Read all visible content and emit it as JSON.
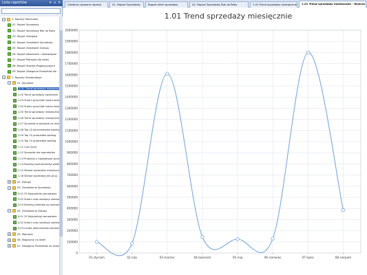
{
  "panel": {
    "title": "Lista raportów",
    "controls": [
      "▾",
      "▫",
      "✕"
    ],
    "search_value": ""
  },
  "tree": [
    {
      "level": 0,
      "expander": "−",
      "icon": "folder",
      "label": "1. Raporty Wzorcowe"
    },
    {
      "level": 1,
      "expander": "",
      "icon": "report",
      "label": "01. Raport Sprzedaży"
    },
    {
      "level": 1,
      "expander": "",
      "icon": "report",
      "label": "02. Raport Sprzedaży Rok do Roku"
    },
    {
      "level": 1,
      "expander": "",
      "icon": "report",
      "label": "03. Raport Zakupów"
    },
    {
      "level": 1,
      "expander": "",
      "icon": "report",
      "label": "04. Raport Zamówień Sprzedaży"
    },
    {
      "level": 1,
      "expander": "",
      "icon": "report",
      "label": "05. Raport Zamówień Zakupu"
    },
    {
      "level": 1,
      "expander": "",
      "icon": "report",
      "label": "06. Raport Należności i Zobowiązań"
    },
    {
      "level": 1,
      "expander": "",
      "icon": "report",
      "label": "07. Raport Płatności Na dzień"
    },
    {
      "level": 1,
      "expander": "",
      "icon": "report",
      "label": "08. Raport Stanów Magazynowych"
    },
    {
      "level": 1,
      "expander": "",
      "icon": "report",
      "label": "09. Raport Zalegania Produktów Na"
    },
    {
      "level": 0,
      "expander": "−",
      "icon": "folder",
      "label": "2. Raporty Standardowe"
    },
    {
      "level": 1,
      "expander": "−",
      "icon": "folder",
      "label": "01. Sprzedaż"
    },
    {
      "level": 2,
      "expander": "",
      "icon": "report",
      "label": "1.01. Trend sprzedaży miesięcznie",
      "selected": true
    },
    {
      "level": 2,
      "expander": "",
      "icon": "report",
      "label": "1.02 Trend sprzedaży kwartalnie"
    },
    {
      "level": 2,
      "expander": "",
      "icon": "report",
      "label": "1.03 Średni przychód marża miesięcznie"
    },
    {
      "level": 2,
      "expander": "",
      "icon": "report",
      "label": "1.04 Średni przychód marża kwartalnie"
    },
    {
      "level": 2,
      "expander": "",
      "icon": "report",
      "label": "1.05 Trend sprzedaży miesięcznie"
    },
    {
      "level": 2,
      "expander": "",
      "icon": "report",
      "label": "1.06 Trend sprzedaży miesięcznie"
    },
    {
      "level": 2,
      "expander": "",
      "icon": "report",
      "label": "1.07 Sprzedaż w podziale na miesiące"
    },
    {
      "level": 2,
      "expander": "",
      "icon": "report",
      "label": "1.08 Top 10 kontrahentów według"
    },
    {
      "level": 2,
      "expander": "",
      "icon": "report",
      "label": "1.09 Top 10 produktów według"
    },
    {
      "level": 2,
      "expander": "",
      "icon": "report",
      "label": "1.10 Top 10 produktów według"
    },
    {
      "level": 2,
      "expander": "",
      "icon": "report",
      "label": "1.11 Cykl życia"
    },
    {
      "level": 2,
      "expander": "",
      "icon": "report",
      "label": "1.12 Sprzedaż dla operatorów"
    },
    {
      "level": 2,
      "expander": "",
      "icon": "report",
      "label": "1.13 Produkty o największej sprzedaży"
    },
    {
      "level": 2,
      "expander": "",
      "icon": "report",
      "label": "1.14 Ranking kontrahentów według"
    },
    {
      "level": 2,
      "expander": "",
      "icon": "report",
      "label": "1.15 Wzrost sprzedaży miesięcznie"
    },
    {
      "level": 2,
      "expander": "",
      "icon": "report",
      "label": "1.16 Wzrost sprzedaży dla grup"
    },
    {
      "level": 1,
      "expander": "+",
      "icon": "folder",
      "label": "02. Zakupy"
    },
    {
      "level": 1,
      "expander": "−",
      "icon": "folder",
      "label": "03. Zamówienia Sprzedaży"
    },
    {
      "level": 2,
      "expander": "",
      "icon": "report",
      "label": "3.01 25 Najczęściej zamawiane"
    },
    {
      "level": 2,
      "expander": "",
      "icon": "report",
      "label": "3.02 Średni czas realizacji zamówień"
    },
    {
      "level": 2,
      "expander": "",
      "icon": "report",
      "label": "3.03 Ranking klientów po wartości"
    },
    {
      "level": 1,
      "expander": "−",
      "icon": "folder",
      "label": "04. Zamówienia Zakupu"
    },
    {
      "level": 2,
      "expander": "",
      "icon": "report",
      "label": "4.01 25 Najczęściej zamawiane"
    },
    {
      "level": 2,
      "expander": "",
      "icon": "report",
      "label": "4.02 Średni czas realizacji zamówień"
    },
    {
      "level": 2,
      "expander": "",
      "icon": "report",
      "label": "4.03 Liczba dokumentów zamówień"
    },
    {
      "level": 1,
      "expander": "+",
      "icon": "folder",
      "label": "05. Płatności"
    },
    {
      "level": 1,
      "expander": "+",
      "icon": "folder",
      "label": "06. Magazyny na dzień"
    },
    {
      "level": 1,
      "expander": "+",
      "icon": "folder",
      "label": "07. Zaleganie Produktów na dzień"
    }
  ],
  "tabs": [
    {
      "label": "Ostatnio używane raporty",
      "active": false
    },
    {
      "label": "01. Raport Sprzedaży",
      "active": false
    },
    {
      "label": "Raport ofert sprzedaży",
      "active": false
    },
    {
      "label": "02. Raport Sprzedaży Rok do Roku",
      "active": false
    },
    {
      "label": "1.01 Trend sprzedaży miesięcznie",
      "active": false
    },
    {
      "label": "1.01 Trend sprzedaży miesięcznie - Wykres",
      "active": true
    }
  ],
  "colors": {
    "line": "#7aa7dc",
    "marker_fill": "#ffffff",
    "grid": "#d0d8e6",
    "selected": "#2f63b6"
  },
  "chart_data": {
    "type": "line",
    "title": "1.01 Trend sprzedaży miesięcznie",
    "categories": [
      "01 styczeń",
      "02 luty",
      "03 marzec",
      "04 kwiecień",
      "05 maj",
      "06 czerwiec",
      "07 lipiec",
      "08 sierpień"
    ],
    "values": [
      100000,
      85000,
      1610000,
      145000,
      125000,
      130000,
      1800000,
      385000
    ],
    "ylim": [
      0,
      2000000
    ],
    "yticks": [
      "0",
      "100000",
      "200000",
      "300000",
      "400000",
      "500000",
      "600000",
      "700000",
      "800000",
      "900000",
      "1000000",
      "1100000",
      "1200000",
      "1300000",
      "1400000",
      "1500000",
      "1600000",
      "1700000",
      "1800000",
      "1900000",
      "2000000"
    ],
    "grid": true,
    "smooth": true
  }
}
